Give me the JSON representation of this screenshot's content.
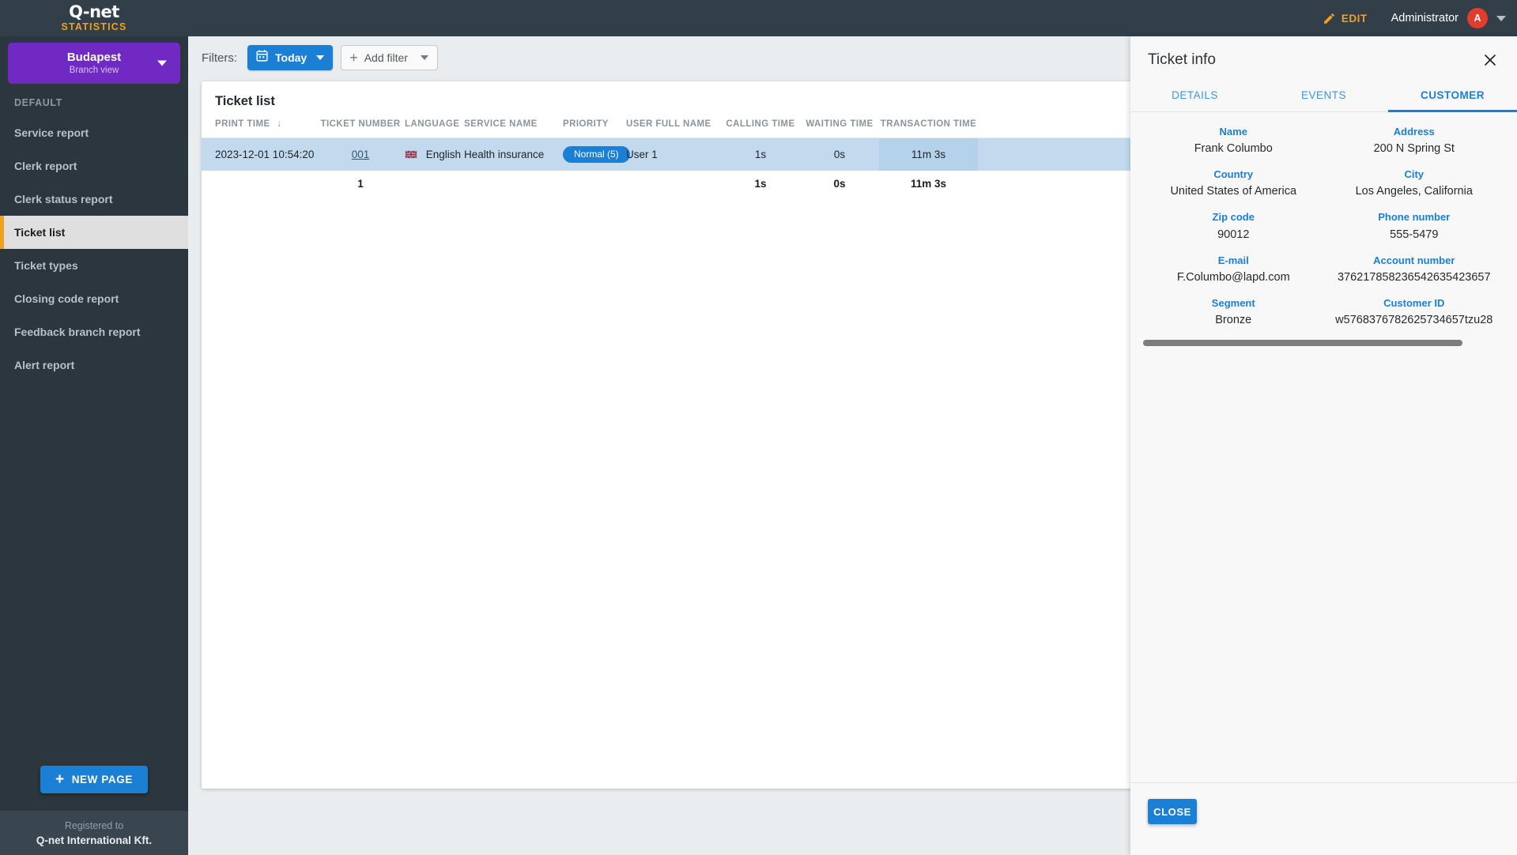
{
  "brand": {
    "logo": "Q-net",
    "subtitle": "STATISTICS"
  },
  "topbar": {
    "edit_label": "EDIT",
    "user_name": "Administrator",
    "avatar_initial": "A"
  },
  "sidebar": {
    "branch": {
      "name": "Budapest",
      "subtitle": "Branch view"
    },
    "group_label": "DEFAULT",
    "items": [
      {
        "label": "Service report",
        "active": false
      },
      {
        "label": "Clerk report",
        "active": false
      },
      {
        "label": "Clerk status report",
        "active": false
      },
      {
        "label": "Ticket list",
        "active": true
      },
      {
        "label": "Ticket types",
        "active": false
      },
      {
        "label": "Closing code report",
        "active": false
      },
      {
        "label": "Feedback branch report",
        "active": false
      },
      {
        "label": "Alert report",
        "active": false
      }
    ],
    "new_page_label": "NEW PAGE",
    "registered_to_label": "Registered to",
    "registered_company": "Q-net International Kft."
  },
  "filters": {
    "label": "Filters:",
    "today_label": "Today",
    "add_filter_label": "Add filter"
  },
  "table": {
    "title": "Ticket list",
    "sort_column": "PRINT TIME",
    "sort_direction": "descending",
    "columns": [
      "PRINT TIME",
      "TICKET NUMBER",
      "LANGUAGE",
      "SERVICE NAME",
      "PRIORITY",
      "USER FULL NAME",
      "CALLING TIME",
      "WAITING TIME",
      "TRANSACTION TIME"
    ],
    "rows": [
      {
        "print_time": "2023-12-01 10:54:20",
        "ticket_number": "001",
        "language": "English",
        "language_flag": "uk-flag-icon",
        "service_name": "Health insurance",
        "priority": "Normal (5)",
        "user_full_name": "User 1",
        "calling_time": "1s",
        "waiting_time": "0s",
        "transaction_time": "11m 3s"
      }
    ],
    "totals": {
      "print_time": "",
      "ticket_number": "1",
      "language": "",
      "service_name": "",
      "priority": "",
      "user_full_name": "",
      "calling_time": "1s",
      "waiting_time": "0s",
      "transaction_time": "11m 3s"
    }
  },
  "panel": {
    "title": "Ticket info",
    "tabs": [
      {
        "label": "DETAILS",
        "active": false
      },
      {
        "label": "EVENTS",
        "active": false
      },
      {
        "label": "CUSTOMER",
        "active": true
      }
    ],
    "customer": {
      "fields": [
        {
          "label": "Name",
          "value": "Frank Columbo"
        },
        {
          "label": "Address",
          "value": "200 N Spring St"
        },
        {
          "label": "Country",
          "value": "United States of America"
        },
        {
          "label": "City",
          "value": "Los Angeles, California"
        },
        {
          "label": "Zip code",
          "value": "90012"
        },
        {
          "label": "Phone number",
          "value": "555-5479"
        },
        {
          "label": "E-mail",
          "value": "F.Columbo@lapd.com"
        },
        {
          "label": "Account number",
          "value": "376217858236542635423657"
        },
        {
          "label": "Segment",
          "value": "Bronze"
        },
        {
          "label": "Customer ID",
          "value": "w5768376782625734657tzu28"
        }
      ]
    },
    "close_label": "CLOSE"
  },
  "colors": {
    "accent_blue": "#1b7fd4",
    "accent_orange": "#f0a21a",
    "branch_purple": "#7129c4",
    "avatar_red": "#e23c2e",
    "sidebar_bg": "#2b363e",
    "topbar_bg": "#323f48",
    "row_selected": "#c3daee",
    "page_bg": "#e9edf0"
  }
}
